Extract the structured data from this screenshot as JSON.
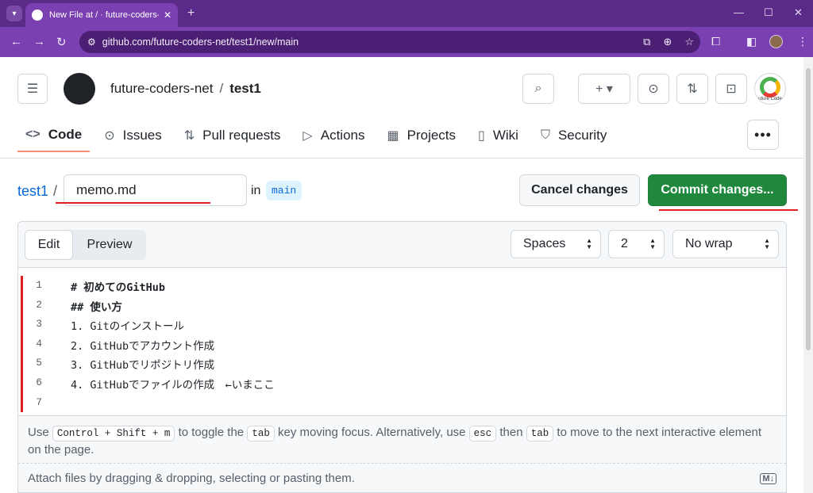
{
  "browser": {
    "tab_title": "New File at / · future-coders-ne",
    "tab_close": "✕",
    "new_tab": "+",
    "minimize": "—",
    "maximize": "☐",
    "close": "✕",
    "back": "←",
    "forward": "→",
    "reload": "↻",
    "url": "github.com/future-coders-net/test1/new/main",
    "site_icon": "site-info-icon"
  },
  "header": {
    "owner": "future-coders-net",
    "separator": "/",
    "repo": "test1",
    "org_avatar_label": "uture Code",
    "plus_label": "+ ▾"
  },
  "repo_tabs": [
    {
      "icon": "<>",
      "label": "Code",
      "active": true
    },
    {
      "icon": "⊙",
      "label": "Issues"
    },
    {
      "icon": "⇅",
      "label": "Pull requests"
    },
    {
      "icon": "▷",
      "label": "Actions"
    },
    {
      "icon": "▦",
      "label": "Projects"
    },
    {
      "icon": "▯",
      "label": "Wiki"
    },
    {
      "icon": "⛉",
      "label": "Security"
    }
  ],
  "more_label": "•••",
  "file": {
    "repo_link": "test1",
    "slash": "/",
    "name": "memo.md",
    "in_label": "in",
    "branch": "main"
  },
  "actions": {
    "cancel": "Cancel changes",
    "commit": "Commit changes..."
  },
  "editor": {
    "edit_tab": "Edit",
    "preview_tab": "Preview",
    "indent_mode": "Spaces",
    "indent_size": "2",
    "wrap_mode": "No wrap",
    "lines": [
      {
        "num": "1",
        "text": "# 初めてのGitHub",
        "bold": true
      },
      {
        "num": "2",
        "text": "## 使い方",
        "bold": true
      },
      {
        "num": "3",
        "text": "1. Gitのインストール"
      },
      {
        "num": "4",
        "text": "2. GitHubでアカウント作成"
      },
      {
        "num": "5",
        "text": "3. GitHubでリポジトリ作成"
      },
      {
        "num": "6",
        "text": "4. GitHubでファイルの作成　←いまここ"
      },
      {
        "num": "7",
        "text": ""
      }
    ]
  },
  "hint": {
    "use": "Use",
    "key1": "Control + Shift + m",
    "t1": "to toggle the",
    "key2": "tab",
    "t2": "key moving focus. Alternatively, use",
    "key3": "esc",
    "t3": "then",
    "key4": "tab",
    "t4": "to move to the next interactive element on the page."
  },
  "attach": {
    "text": "Attach files by dragging & dropping, selecting or pasting them.",
    "md_badge": "M↓"
  },
  "colors": {
    "chrome": "#7a3fb0",
    "commit_green": "#1f883d",
    "link_blue": "#0969da",
    "annotation_red": "#e02020"
  }
}
